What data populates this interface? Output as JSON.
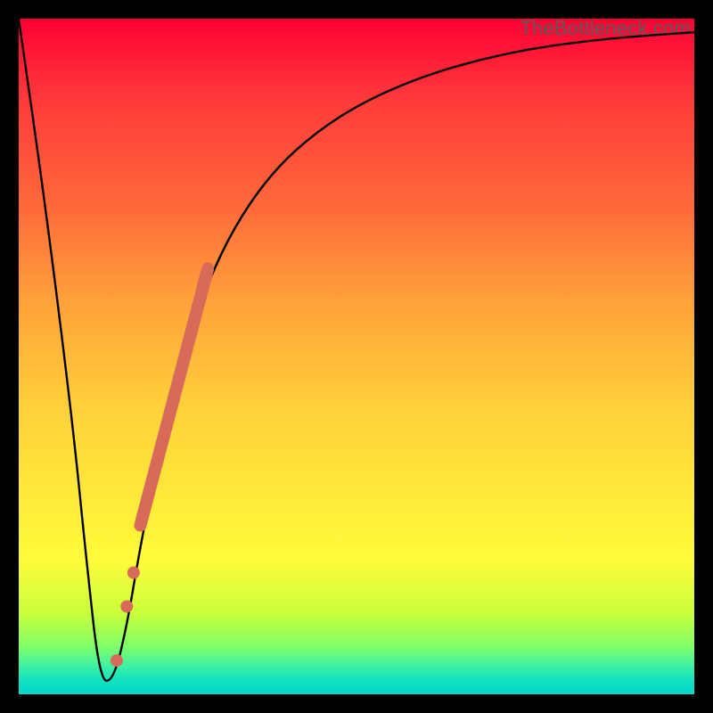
{
  "watermark": "TheBottleneck.com",
  "colors": {
    "marker": "#d86a5a",
    "curve": "#000000"
  },
  "chart_data": {
    "type": "line",
    "title": "",
    "xlabel": "",
    "ylabel": "",
    "xlim": [
      0,
      100
    ],
    "ylim": [
      0,
      100
    ],
    "grid": false,
    "series": [
      {
        "name": "bottleneck-curve",
        "x": [
          0,
          4,
          8,
          10,
          12,
          14,
          16,
          18,
          22,
          28,
          36,
          46,
          58,
          72,
          86,
          100
        ],
        "y": [
          100,
          72,
          40,
          20,
          2,
          2,
          10,
          22,
          42,
          62,
          76,
          85,
          91,
          95,
          97,
          98
        ]
      }
    ],
    "markers": {
      "thick_segment": {
        "x0": 18,
        "y0": 25,
        "x1": 28,
        "y1": 63
      },
      "dots": [
        {
          "x": 16.0,
          "y": 13
        },
        {
          "x": 14.5,
          "y": 5
        },
        {
          "x": 17.0,
          "y": 18
        }
      ]
    }
  }
}
